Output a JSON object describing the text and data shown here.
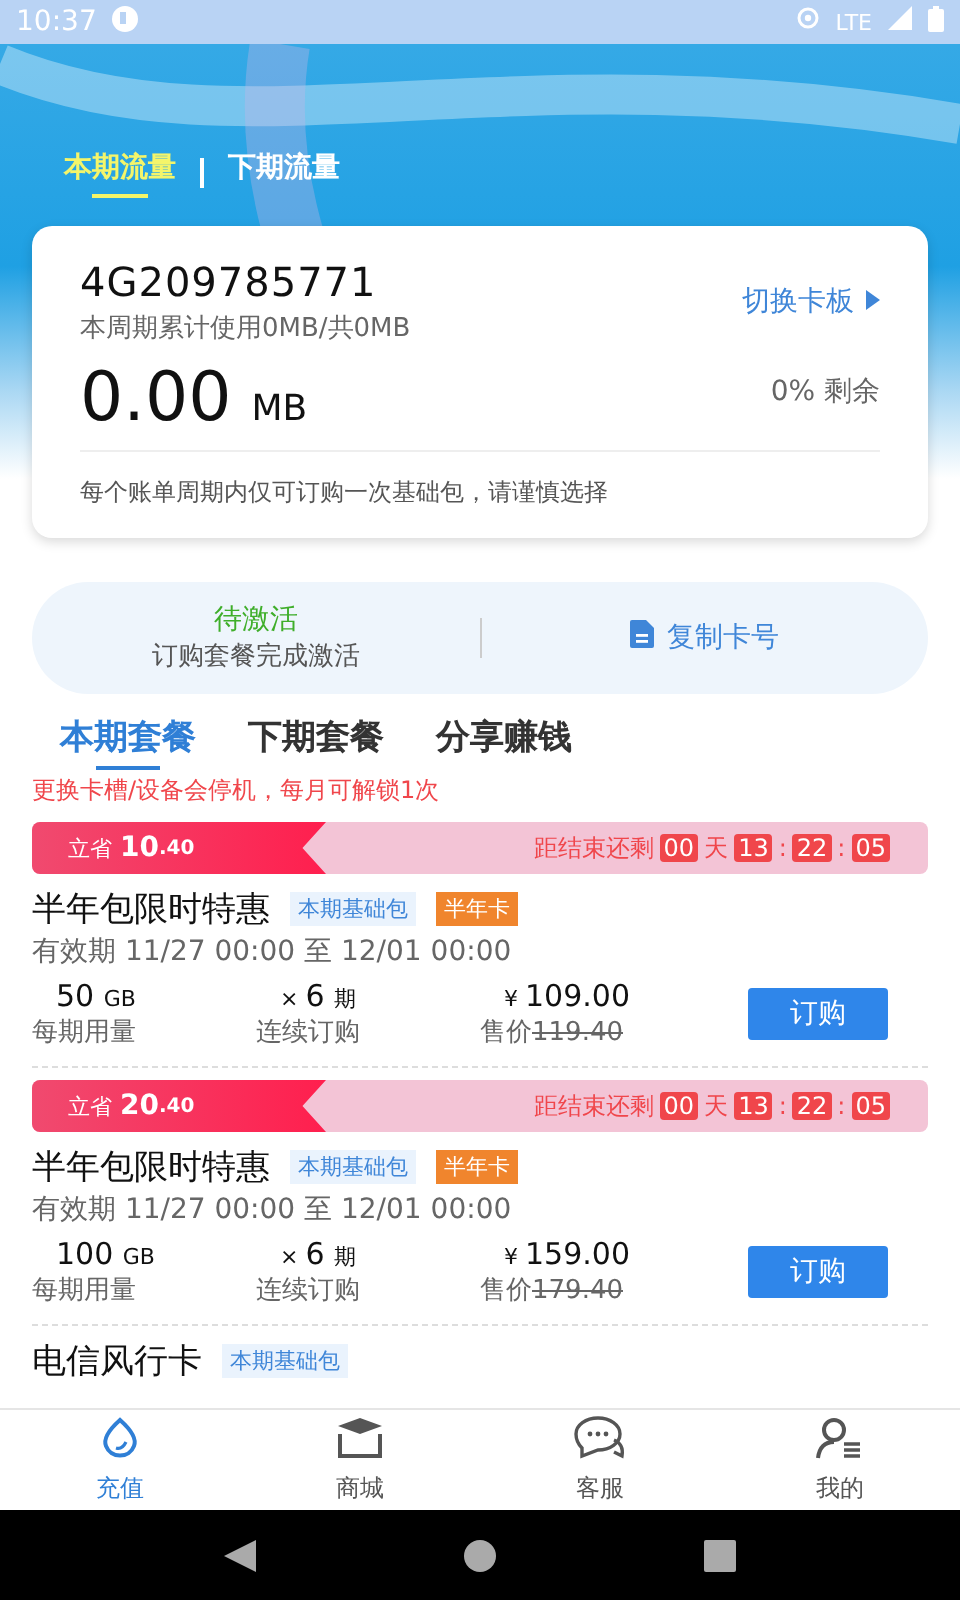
{
  "status_bar": {
    "time": "10:37",
    "network": "LTE"
  },
  "flow_tabs": [
    {
      "label": "本期流量",
      "selected": true
    },
    {
      "label": "下期流量",
      "selected": false
    }
  ],
  "card": {
    "number": "4G209785771",
    "usage": "本周期累计使用0MB/共0MB",
    "switch_link": "切换卡板",
    "amount": "0.00",
    "unit": "MB",
    "remaining": "0% 剩余",
    "notice": "每个账单周期内仅可订购一次基础包，请谨慎选择"
  },
  "activation": {
    "status": "待激活",
    "hint": "订购套餐完成激活",
    "copy_button": "复制卡号"
  },
  "package_tabs": [
    {
      "label": "本期套餐",
      "selected": true
    },
    {
      "label": "下期套餐",
      "selected": false
    },
    {
      "label": "分享赚钱",
      "selected": false
    }
  ],
  "warning": "更换卡槽/设备会停机，每月可解锁1次",
  "packages": [
    {
      "kind": "promo",
      "save_label": "立省",
      "save_amount": "10",
      "save_decimals": ".40",
      "countdown_label": "距结束还剩",
      "days": "00",
      "day_unit": "天",
      "hours": "13",
      "minutes": "22",
      "seconds": "05",
      "time_separators": [
        ":",
        ":"
      ],
      "title": "半年包限时特惠",
      "tags": [
        {
          "label": "本期基础包",
          "kind": "base"
        },
        {
          "label": "半年卡",
          "kind": "period"
        }
      ],
      "validity": "有效期 11/27 00:00 至 12/01 00:00",
      "data_amount": "50",
      "data_unit": "GB",
      "data_label": "每期用量",
      "times": "×",
      "periods": "6",
      "period_unit": "期",
      "periods_label": "连续订购",
      "currency": "¥",
      "price": "109.00",
      "price_label": "售价",
      "original_price": "119.40",
      "button": "订购"
    },
    {
      "kind": "promo",
      "save_label": "立省",
      "save_amount": "20",
      "save_decimals": ".40",
      "countdown_label": "距结束还剩",
      "days": "00",
      "day_unit": "天",
      "hours": "13",
      "minutes": "22",
      "seconds": "05",
      "time_separators": [
        ":",
        ":"
      ],
      "title": "半年包限时特惠",
      "tags": [
        {
          "label": "本期基础包",
          "kind": "base"
        },
        {
          "label": "半年卡",
          "kind": "period"
        }
      ],
      "validity": "有效期 11/27 00:00 至 12/01 00:00",
      "data_amount": "100",
      "data_unit": "GB",
      "data_label": "每期用量",
      "times": "×",
      "periods": "6",
      "period_unit": "期",
      "periods_label": "连续订购",
      "currency": "¥",
      "price": "159.00",
      "price_label": "售价",
      "original_price": "179.40",
      "button": "订购"
    },
    {
      "kind": "plain",
      "title": "电信风行卡",
      "tags": [
        {
          "label": "本期基础包",
          "kind": "base"
        }
      ]
    }
  ],
  "bottom_nav": [
    {
      "label": "充值",
      "selected": true
    },
    {
      "label": "商城",
      "selected": false
    },
    {
      "label": "客服",
      "selected": false
    },
    {
      "label": "我的",
      "selected": false
    }
  ]
}
